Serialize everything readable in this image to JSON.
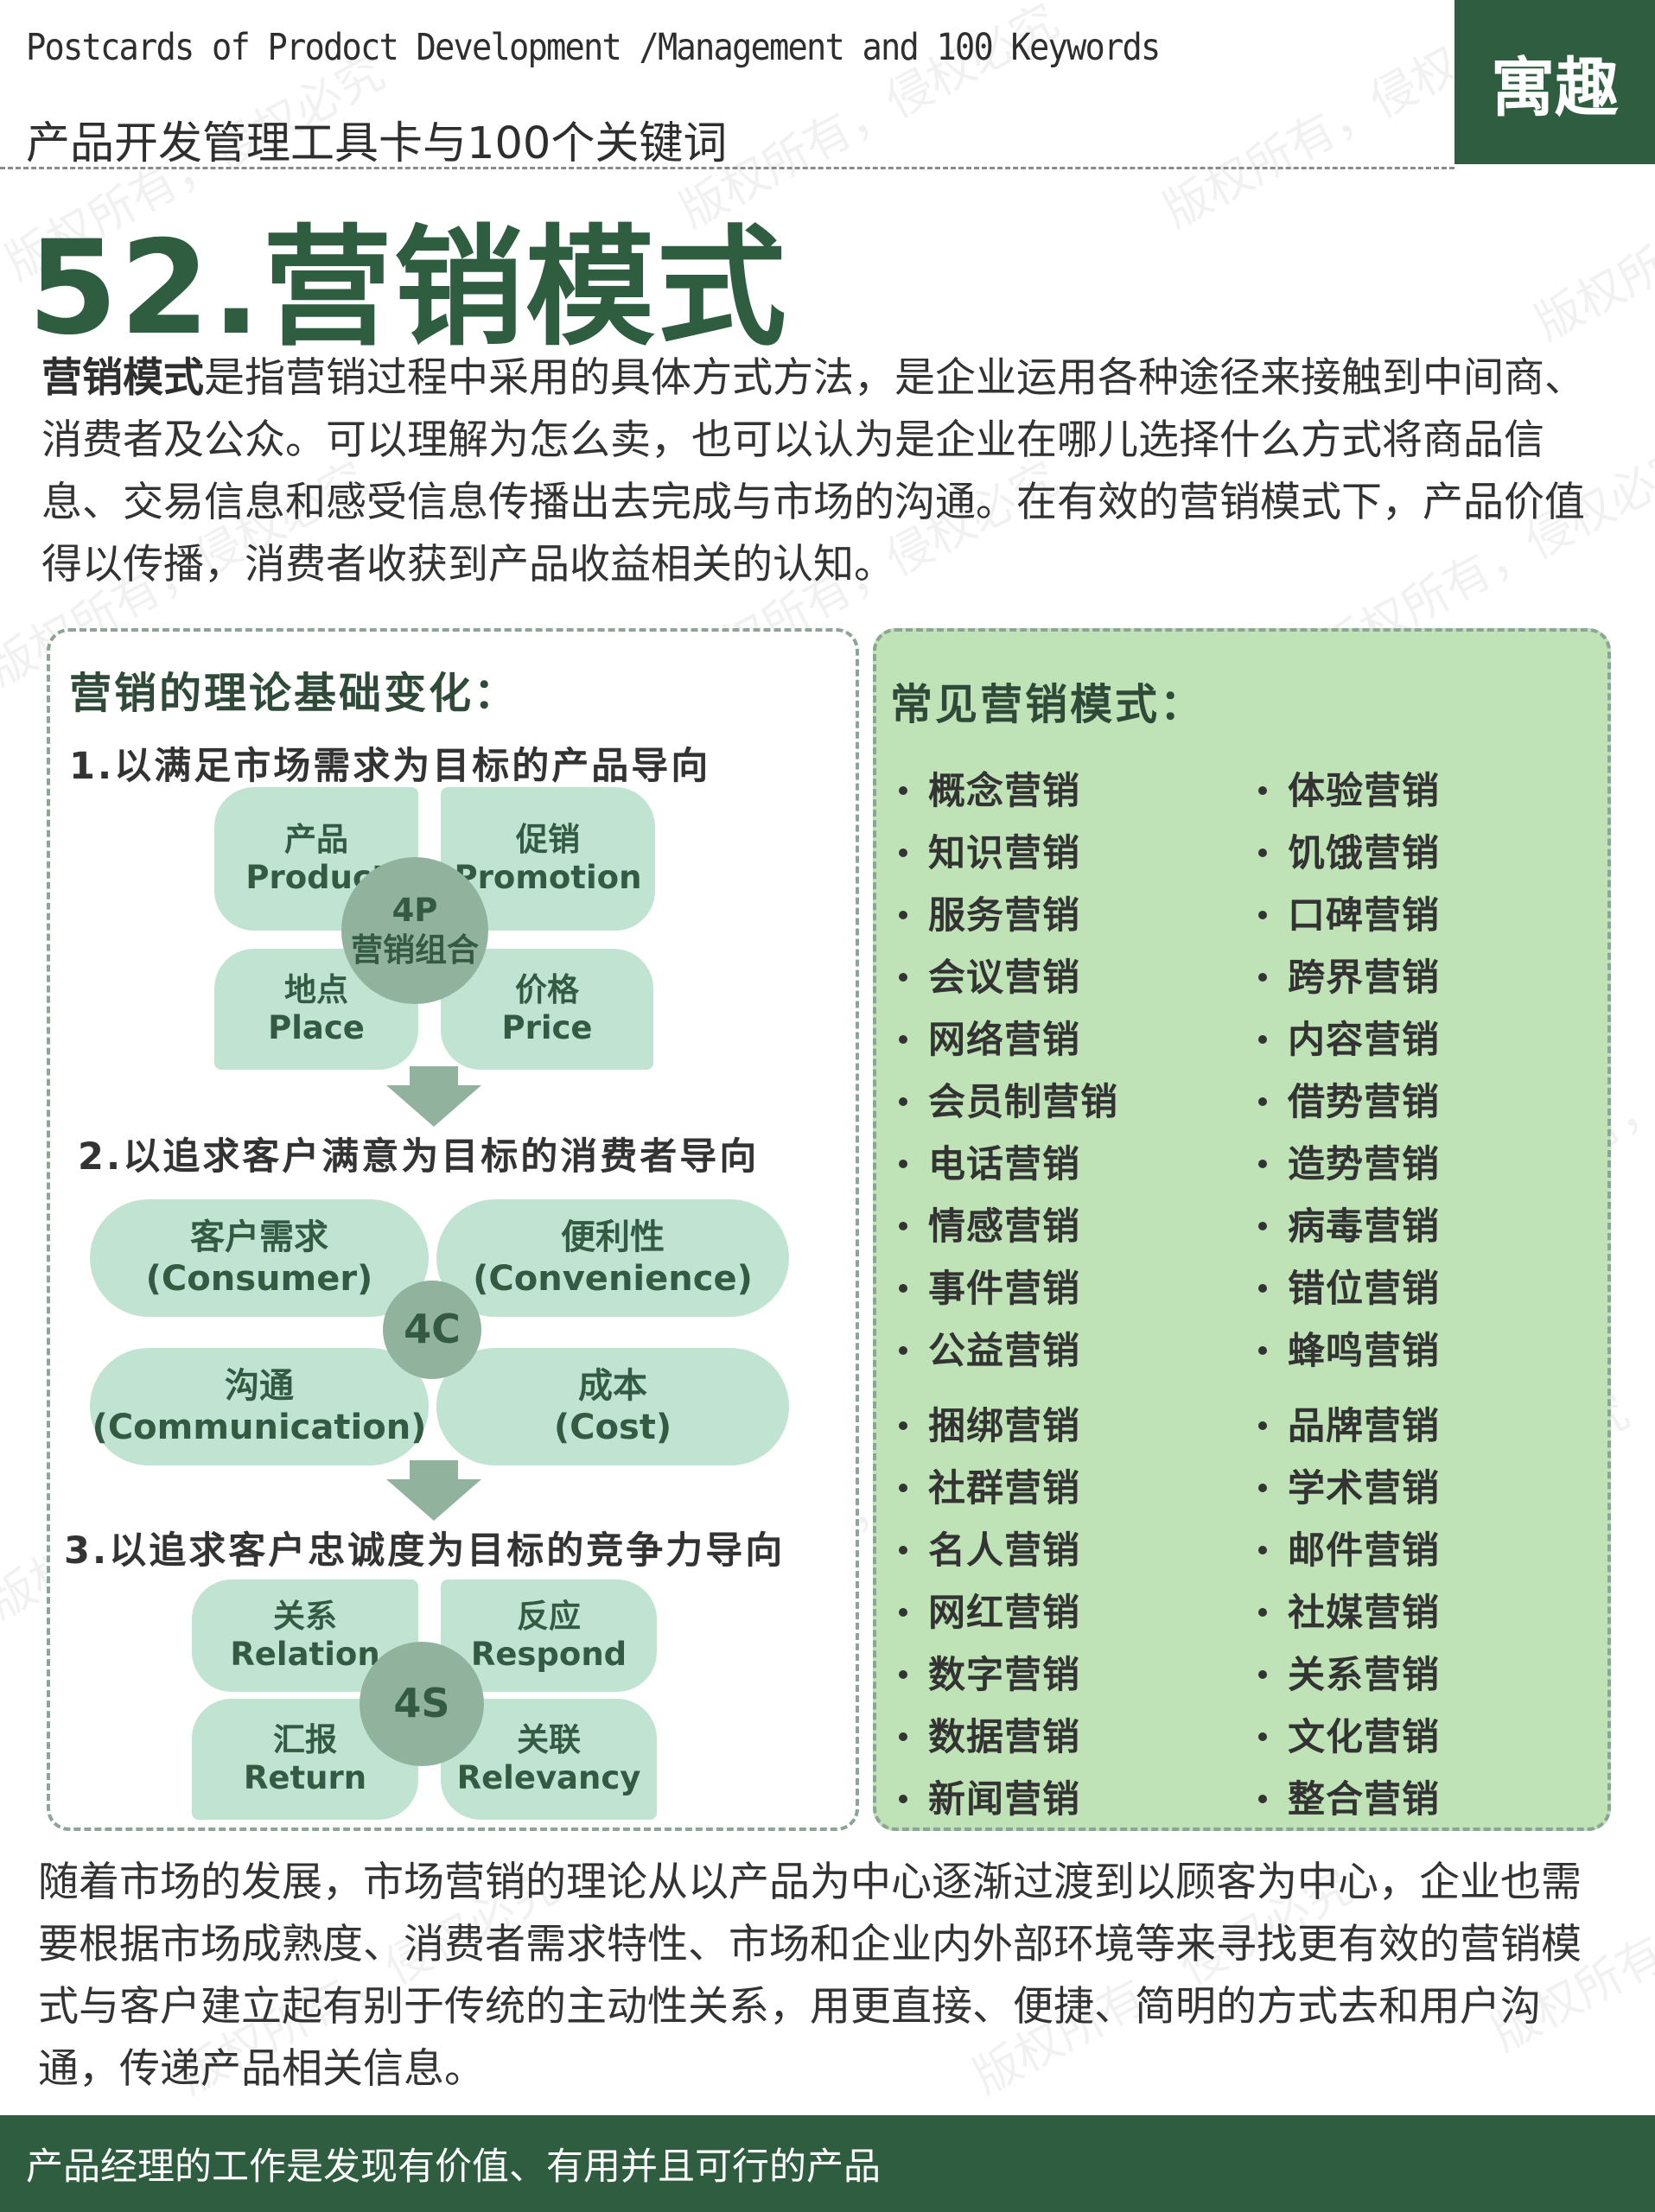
{
  "header": {
    "title_en": "Postcards of Prodoct Development /Management and 100 Keywords",
    "title_cn": "产品开发管理工具卡与100个关键词",
    "brand": "寓趣"
  },
  "watermark": "版权所有，侵权必究",
  "title": "52.营销模式",
  "intro": {
    "keyword": "营销模式",
    "text": "是指营销过程中采用的具体方式方法，是企业运用各种途径来接触到中间商、消费者及公众。可以理解为怎么卖，也可以认为是企业在哪儿选择什么方式将商品信息、交易信息和感受信息传播出去完成与市场的沟通。在有效的营销模式下，产品价值得以传播，消费者收获到产品收益相关的认知。"
  },
  "left_panel": {
    "heading": "营销的理论基础变化：",
    "s1": {
      "title": "1.以满足市场需求为目标的产品导向",
      "center": [
        "4P",
        "营销组合"
      ],
      "tl": [
        "产品",
        "Product"
      ],
      "tr": [
        "促销",
        "Promotion"
      ],
      "bl": [
        "地点",
        "Place"
      ],
      "br": [
        "价格",
        "Price"
      ]
    },
    "s2": {
      "title": "2.以追求客户满意为目标的消费者导向",
      "center": "4C",
      "tl": [
        "客户需求",
        "(Consumer)"
      ],
      "tr": [
        "便利性",
        "(Convenience)"
      ],
      "bl": [
        "沟通",
        "(Communication)"
      ],
      "br": [
        "成本",
        "(Cost)"
      ]
    },
    "s3": {
      "title": "3.以追求客户忠诚度为目标的竞争力导向",
      "center": "4S",
      "tl": [
        "关系",
        "Relation"
      ],
      "tr": [
        "反应",
        "Respond"
      ],
      "bl": [
        "汇报",
        "Return"
      ],
      "br": [
        "关联",
        "Relevancy"
      ]
    }
  },
  "right_panel": {
    "heading": "常见营销模式：",
    "col1": [
      "概念营销",
      "知识营销",
      "服务营销",
      "会议营销",
      "网络营销",
      "会员制营销",
      "电话营销",
      "情感营销",
      "事件营销",
      "公益营销",
      "捆绑营销",
      "社群营销",
      "名人营销",
      "网红营销",
      "数字营销",
      "数据营销",
      "新闻营销"
    ],
    "col2": [
      "体验营销",
      "饥饿营销",
      "口碑营销",
      "跨界营销",
      "内容营销",
      "借势营销",
      "造势营销",
      "病毒营销",
      "错位营销",
      "蜂鸣营销",
      "品牌营销",
      "学术营销",
      "邮件营销",
      "社媒营销",
      "关系营销",
      "文化营销",
      "整合营销"
    ]
  },
  "outro": "随着市场的发展，市场营销的理论从以产品为中心逐渐过渡到以顾客为中心，企业也需要根据市场成熟度、消费者需求特性、市场和企业内外部环境等来寻找更有效的营销模式与客户建立起有别于传统的主动性关系，用更直接、便捷、简明的方式去和用户沟通，传递产品相关信息。",
  "footer": "产品经理的工作是发现有价值、有用并且可行的产品",
  "colors": {
    "brand_green": "#2f5d3f",
    "panel_green": "#bfe2b6",
    "petal": "#c1e3d2",
    "circle": "#91b39e"
  }
}
